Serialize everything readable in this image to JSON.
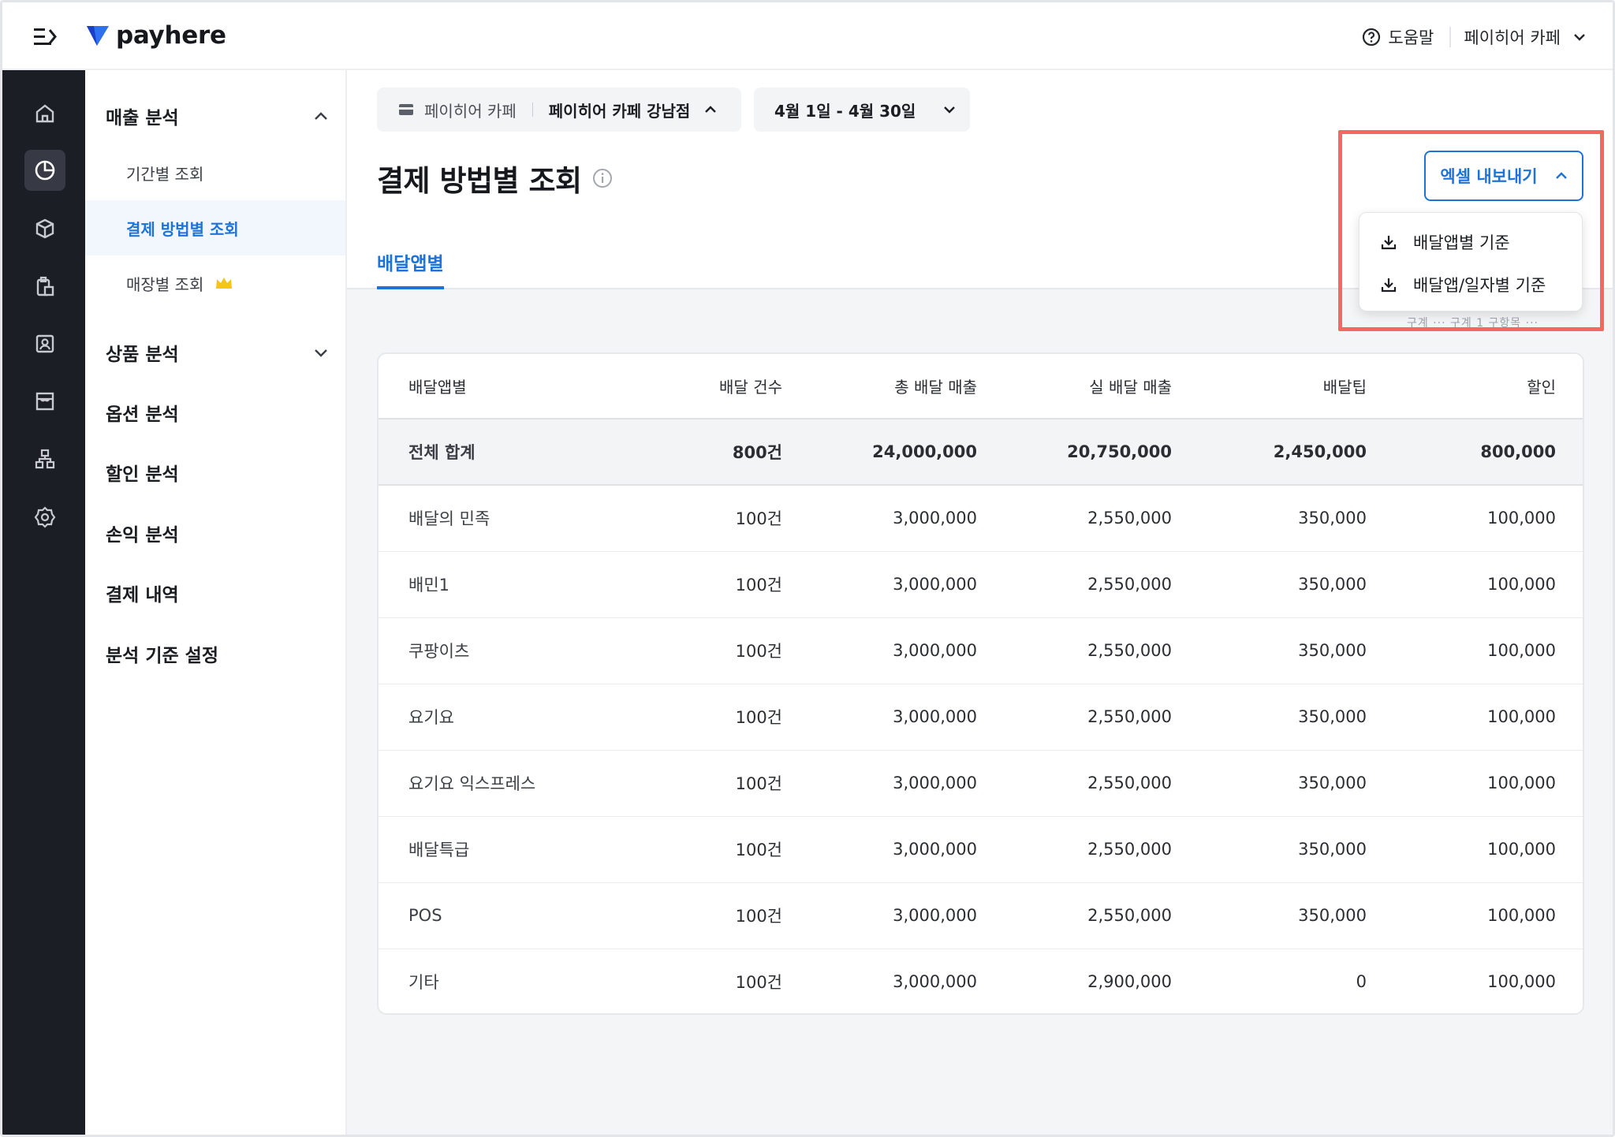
{
  "header": {
    "logo_text": "payhere",
    "help_label": "도움말",
    "store_label": "페이히어 카페"
  },
  "rail": {
    "icons": [
      "home-icon",
      "pie-chart-icon",
      "box-icon",
      "clipboard-icon",
      "person-card-icon",
      "store-icon",
      "org-chart-icon",
      "settings-icon"
    ],
    "active_index": 1
  },
  "subnav": {
    "sales_group": "매출 분석",
    "sales_items": [
      "기간별 조회",
      "결제 방법별 조회",
      "매장별 조회"
    ],
    "product_group": "상품 분석",
    "others": [
      "옵션 분석",
      "할인 분석",
      "손익 분석",
      "결제 내역",
      "분석 기준 설정"
    ]
  },
  "filters": {
    "store_brand": "페이히어 카페",
    "store_branch": "페이히어 카페 강남점",
    "date_range": "4월 1일 - 4월 30일"
  },
  "page": {
    "title": "결제 방법별 조회",
    "tab": "배달앱별",
    "peek_text": "구계 ··· 구계 1 구항목 ···"
  },
  "export": {
    "button_label": "엑셀 내보내기",
    "options": [
      "배달앱별 기준",
      "배달앱/일자별 기준"
    ]
  },
  "table": {
    "headers": [
      "배달앱별",
      "배달 건수",
      "총 배달 매출",
      "실 배달 매출",
      "배달팁",
      "할인"
    ],
    "total": [
      "전체 합계",
      "800건",
      "24,000,000",
      "20,750,000",
      "2,450,000",
      "800,000"
    ],
    "rows": [
      [
        "배달의 민족",
        "100건",
        "3,000,000",
        "2,550,000",
        "350,000",
        "100,000"
      ],
      [
        "배민1",
        "100건",
        "3,000,000",
        "2,550,000",
        "350,000",
        "100,000"
      ],
      [
        "쿠팡이츠",
        "100건",
        "3,000,000",
        "2,550,000",
        "350,000",
        "100,000"
      ],
      [
        "요기요",
        "100건",
        "3,000,000",
        "2,550,000",
        "350,000",
        "100,000"
      ],
      [
        "요기요 익스프레스",
        "100건",
        "3,000,000",
        "2,550,000",
        "350,000",
        "100,000"
      ],
      [
        "배달특급",
        "100건",
        "3,000,000",
        "2,550,000",
        "350,000",
        "100,000"
      ],
      [
        "POS",
        "100건",
        "3,000,000",
        "2,550,000",
        "350,000",
        "100,000"
      ],
      [
        "기타",
        "100건",
        "3,000,000",
        "2,900,000",
        "0",
        "100,000"
      ]
    ]
  },
  "colors": {
    "accent": "#1e73d8",
    "rail_bg": "#1c1e25",
    "highlight": "#f06a5f",
    "crown": "#f5c518"
  }
}
